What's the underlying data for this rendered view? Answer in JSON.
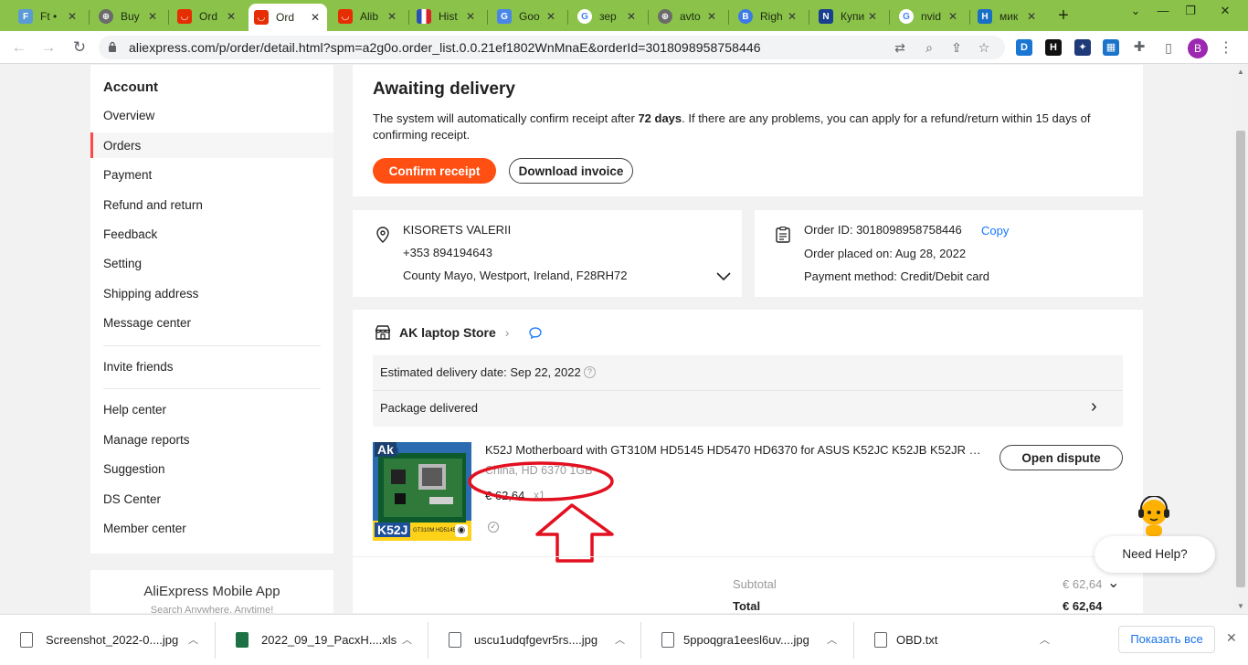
{
  "browser": {
    "tabs": [
      {
        "title": "Ft • ",
        "color": "#5b9bd5",
        "glyph": "F"
      },
      {
        "title": "Buy",
        "color": "#6b6b6b",
        "glyph": "⊕"
      },
      {
        "title": "Ord",
        "color": "#e62e04",
        "glyph": "◡"
      },
      {
        "title": "Ord",
        "color": "#e62e04",
        "glyph": "◡",
        "active": true
      },
      {
        "title": "Alib",
        "color": "#e62e04",
        "glyph": "◡"
      },
      {
        "title": "Hist",
        "color": "#2b4fb5",
        "glyph": "▮"
      },
      {
        "title": "Goo",
        "color": "#4a86e8",
        "glyph": "G"
      },
      {
        "title": "зер",
        "color": "#4285f4",
        "glyph": "G"
      },
      {
        "title": "avto",
        "color": "#6b6b6b",
        "glyph": "⊕"
      },
      {
        "title": "Righ",
        "color": "#3d7ae8",
        "glyph": "B"
      },
      {
        "title": "Купи",
        "color": "#1a3f8f",
        "glyph": "N"
      },
      {
        "title": "nvid",
        "color": "#4285f4",
        "glyph": "G"
      },
      {
        "title": "мик",
        "color": "#1a6fc4",
        "glyph": "H"
      }
    ],
    "url": "aliexpress.com/p/order/detail.html?spm=a2g0o.order_list.0.0.21ef1802WnMnaE&orderId=3018098958758446",
    "profile_initial": "B"
  },
  "sidebar": {
    "heading": "Account",
    "items": [
      "Overview",
      "Orders",
      "Payment",
      "Refund and return",
      "Feedback",
      "Setting",
      "Shipping address",
      "Message center",
      "Invite friends",
      "Help center",
      "Manage reports",
      "Suggestion",
      "DS Center",
      "Member center"
    ],
    "active_item": "Orders",
    "mobile_app": "AliExpress Mobile App",
    "mobile_sub": "Search Anywhere, Anytime!"
  },
  "status": {
    "title": "Awaiting delivery",
    "text_before": "The system will automatically confirm receipt after ",
    "days": "72 days",
    "text_after": ". If there are any problems, you can apply for a refund/return within 15 days of confirming receipt.",
    "confirm_label": "Confirm receipt",
    "invoice_label": "Download invoice"
  },
  "address": {
    "name": "KISORETS VALERII",
    "phone": "+353 894194643",
    "location": "County Mayo, Westport, Ireland, F28RH72"
  },
  "order": {
    "id_label": "Order ID: 3018098958758446",
    "copy_label": "Copy",
    "placed": "Order placed on: Aug 28, 2022",
    "payment": "Payment method: Credit/Debit card"
  },
  "store": {
    "name": "AK laptop Store",
    "delivery_estimate": "Estimated delivery date: Sep 22, 2022",
    "package_status": "Package delivered"
  },
  "product": {
    "title": "K52J Motherboard with GT310M HD5145 HD5470 HD6370 for ASUS K52JC K52JB K52JR K5...",
    "variant": "China, HD 6370 1GB",
    "price": "€ 62,64",
    "qty": "x1",
    "dispute_label": "Open dispute",
    "image_badge": "Ak",
    "image_model": "K52J",
    "image_caption": "GT310M HD5145C"
  },
  "summary": {
    "subtotal_label": "Subtotal",
    "subtotal_value": "€ 62,64",
    "total_label": "Total",
    "total_value": "€ 62,64"
  },
  "help_label": "Need Help?",
  "downloads": {
    "files": [
      {
        "name": "Screenshot_2022-0....jpg",
        "type": "file"
      },
      {
        "name": "2022_09_19_PacxH....xls",
        "type": "xls"
      },
      {
        "name": "uscu1udqfgevr5rs....jpg",
        "type": "file"
      },
      {
        "name": "5ppoqgra1eesl6uv....jpg",
        "type": "file"
      },
      {
        "name": "OBD.txt",
        "type": "file"
      }
    ],
    "show_all": "Показать все"
  },
  "colors": {
    "accent": "#ff4f12",
    "tabstrip": "#8bc34a",
    "link": "#1677ff",
    "annotation": "#e3101f"
  }
}
